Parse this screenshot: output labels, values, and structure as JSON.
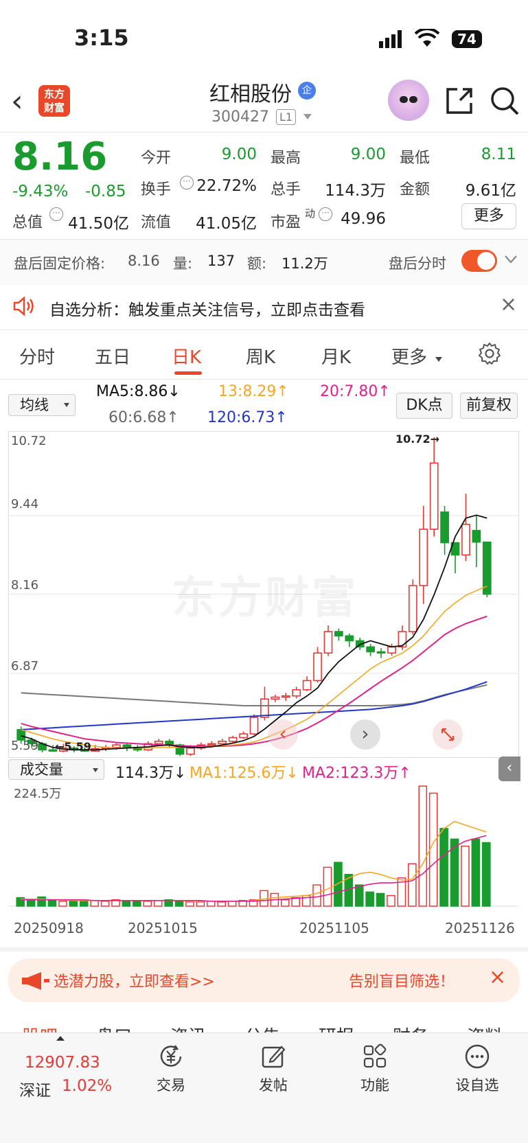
{
  "status_bar": {
    "time": "3:15",
    "battery": "74"
  },
  "header": {
    "logo_line1": "东方",
    "logo_line2": "财富",
    "stock_name": "红相股份",
    "badge": "企",
    "code": "300427",
    "level": "L1"
  },
  "quote": {
    "price": "8.16",
    "change_pct": "-9.43%",
    "change": "-0.85",
    "open_label": "今开",
    "open": "9.00",
    "high_label": "最高",
    "high": "9.00",
    "low_label": "最低",
    "low": "8.11",
    "turnover_label": "换手",
    "turnover": "22.72%",
    "volume_label": "总手",
    "volume": "114.3万",
    "amount_label": "金额",
    "amount": "9.61亿",
    "mcap_label": "总值",
    "mcap": "41.50亿",
    "float_label": "流值",
    "float": "41.05亿",
    "pe_label": "市盈",
    "pe_sup": "动",
    "pe": "49.96",
    "more": "更多"
  },
  "after_hours": {
    "price_label": "盘后固定价格:",
    "price": "8.16",
    "vol_label": "量:",
    "vol": "137",
    "amt_label": "额:",
    "amt": "11.2万",
    "toggle_label": "盘后分时"
  },
  "notice": {
    "text": "自选分析：触发重点关注信号，立即点击查看"
  },
  "tabs": [
    "分时",
    "五日",
    "日K",
    "周K",
    "月K",
    "更多"
  ],
  "ma": {
    "selector": "均线",
    "ma5": "MA5:8.86↓",
    "ma13": "13:8.29↑",
    "ma20": "20:7.80↑",
    "ma60": "60:6.68↑",
    "ma120": "120:6.73↑",
    "dk": "DK点",
    "fq": "前复权"
  },
  "colors": {
    "up": "#e53935",
    "down": "#1a9b2e",
    "ma5": "#111111",
    "ma13": "#f5a623",
    "ma20": "#e0218a",
    "ma60": "#777777",
    "ma120": "#2436c9",
    "accent": "#e8472a"
  },
  "chart": {
    "y_labels": [
      "10.72",
      "9.44",
      "8.16",
      "6.87",
      "5.59"
    ],
    "max_label": "10.72→",
    "min_label": "←5.59",
    "watermark": "东方财富"
  },
  "volume": {
    "selector": "成交量",
    "cur": "114.3万↓",
    "ma1": "MA1:125.6万↓",
    "ma2": "MA2:123.3万↑",
    "max_label": "224.5万"
  },
  "x_labels": [
    "20250918",
    "20251015",
    "20251105",
    "20251126"
  ],
  "chart_data": {
    "type": "candlestick",
    "candles": [
      [
        5.95,
        5.78,
        6.0,
        5.72
      ],
      [
        5.78,
        5.72,
        5.82,
        5.65
      ],
      [
        5.72,
        5.62,
        5.75,
        5.58
      ],
      [
        5.62,
        5.6,
        5.7,
        5.59
      ],
      [
        5.6,
        5.65,
        5.72,
        5.58
      ],
      [
        5.65,
        5.62,
        5.68,
        5.58
      ],
      [
        5.62,
        5.6,
        5.66,
        5.59
      ],
      [
        5.6,
        5.64,
        5.7,
        5.59
      ],
      [
        5.64,
        5.66,
        5.7,
        5.6
      ],
      [
        5.66,
        5.7,
        5.74,
        5.62
      ],
      [
        5.7,
        5.66,
        5.72,
        5.6
      ],
      [
        5.66,
        5.62,
        5.7,
        5.59
      ],
      [
        5.62,
        5.72,
        5.76,
        5.6
      ],
      [
        5.72,
        5.76,
        5.8,
        5.68
      ],
      [
        5.76,
        5.7,
        5.8,
        5.66
      ],
      [
        5.7,
        5.55,
        5.72,
        5.52
      ],
      [
        5.55,
        5.65,
        5.7,
        5.52
      ],
      [
        5.65,
        5.7,
        5.74,
        5.62
      ],
      [
        5.7,
        5.72,
        5.76,
        5.66
      ],
      [
        5.72,
        5.76,
        5.8,
        5.7
      ],
      [
        5.76,
        5.82,
        5.85,
        5.74
      ],
      [
        5.82,
        5.88,
        5.92,
        5.8
      ],
      [
        5.88,
        6.15,
        6.2,
        5.86
      ],
      [
        6.15,
        6.45,
        6.65,
        6.1
      ],
      [
        6.45,
        6.48,
        6.52,
        6.4
      ],
      [
        6.48,
        6.5,
        6.55,
        6.42
      ],
      [
        6.5,
        6.6,
        6.65,
        6.46
      ],
      [
        6.6,
        6.75,
        6.82,
        6.58
      ],
      [
        6.75,
        7.2,
        7.3,
        6.72
      ],
      [
        7.2,
        7.55,
        7.65,
        7.15
      ],
      [
        7.55,
        7.48,
        7.6,
        7.4
      ],
      [
        7.48,
        7.4,
        7.52,
        7.3
      ],
      [
        7.4,
        7.3,
        7.45,
        7.25
      ],
      [
        7.3,
        7.22,
        7.35,
        7.15
      ],
      [
        7.22,
        7.2,
        7.28,
        7.12
      ],
      [
        7.2,
        7.3,
        7.35,
        7.16
      ],
      [
        7.3,
        7.55,
        7.65,
        7.25
      ],
      [
        7.55,
        8.3,
        8.4,
        7.5
      ],
      [
        8.3,
        9.22,
        9.6,
        8.0
      ],
      [
        9.22,
        10.3,
        10.72,
        9.1
      ],
      [
        9.5,
        9.0,
        9.6,
        8.8
      ],
      [
        9.0,
        8.8,
        9.0,
        8.5
      ],
      [
        8.8,
        9.3,
        9.8,
        8.7
      ],
      [
        9.2,
        9.01,
        9.45,
        8.6
      ],
      [
        9.01,
        8.16,
        9.0,
        8.11
      ]
    ],
    "ma5": [
      5.85,
      5.8,
      5.72,
      5.66,
      5.63,
      5.62,
      5.62,
      5.62,
      5.63,
      5.64,
      5.65,
      5.66,
      5.67,
      5.69,
      5.7,
      5.67,
      5.66,
      5.66,
      5.67,
      5.7,
      5.73,
      5.77,
      5.84,
      5.96,
      6.1,
      6.24,
      6.39,
      6.5,
      6.63,
      6.87,
      7.06,
      7.2,
      7.34,
      7.4,
      7.35,
      7.3,
      7.32,
      7.46,
      7.75,
      8.15,
      8.6,
      9.1,
      9.4,
      9.45,
      9.4
    ],
    "ma13": [
      5.95,
      5.9,
      5.85,
      5.8,
      5.76,
      5.73,
      5.7,
      5.68,
      5.66,
      5.65,
      5.65,
      5.65,
      5.65,
      5.66,
      5.66,
      5.66,
      5.66,
      5.67,
      5.68,
      5.69,
      5.7,
      5.72,
      5.75,
      5.81,
      5.88,
      5.95,
      6.03,
      6.12,
      6.24,
      6.38,
      6.52,
      6.66,
      6.8,
      6.94,
      7.05,
      7.12,
      7.2,
      7.32,
      7.48,
      7.68,
      7.88,
      8.02,
      8.14,
      8.22,
      8.29
    ],
    "ma20": [
      6.05,
      6.0,
      5.96,
      5.92,
      5.88,
      5.84,
      5.8,
      5.78,
      5.76,
      5.74,
      5.73,
      5.72,
      5.71,
      5.7,
      5.7,
      5.69,
      5.68,
      5.68,
      5.68,
      5.68,
      5.69,
      5.7,
      5.72,
      5.75,
      5.79,
      5.84,
      5.9,
      5.97,
      6.06,
      6.16,
      6.27,
      6.38,
      6.5,
      6.62,
      6.74,
      6.85,
      6.96,
      7.08,
      7.22,
      7.36,
      7.5,
      7.6,
      7.68,
      7.74,
      7.8
    ],
    "ma60": [
      6.55,
      6.54,
      6.53,
      6.52,
      6.51,
      6.5,
      6.49,
      6.48,
      6.47,
      6.46,
      6.45,
      6.44,
      6.43,
      6.42,
      6.41,
      6.4,
      6.39,
      6.38,
      6.37,
      6.36,
      6.35,
      6.34,
      6.34,
      6.34,
      6.34,
      6.34,
      6.34,
      6.34,
      6.34,
      6.34,
      6.34,
      6.34,
      6.34,
      6.34,
      6.34,
      6.35,
      6.36,
      6.38,
      6.42,
      6.47,
      6.52,
      6.56,
      6.6,
      6.64,
      6.68
    ],
    "ma120": [
      5.95,
      5.96,
      5.97,
      5.98,
      5.99,
      6.0,
      6.01,
      6.02,
      6.03,
      6.04,
      6.05,
      6.06,
      6.07,
      6.08,
      6.09,
      6.1,
      6.11,
      6.12,
      6.13,
      6.14,
      6.15,
      6.16,
      6.17,
      6.18,
      6.19,
      6.2,
      6.21,
      6.22,
      6.23,
      6.24,
      6.25,
      6.26,
      6.27,
      6.28,
      6.3,
      6.32,
      6.34,
      6.37,
      6.41,
      6.46,
      6.51,
      6.56,
      6.61,
      6.67,
      6.73
    ],
    "volumes": [
      12,
      9,
      13,
      8,
      7,
      8,
      7,
      8,
      7,
      9,
      7,
      8,
      7,
      8,
      9,
      7,
      6,
      6,
      7,
      6,
      7,
      8,
      9,
      22,
      18,
      9,
      12,
      15,
      30,
      55,
      62,
      45,
      30,
      20,
      18,
      15,
      40,
      60,
      170,
      160,
      110,
      95,
      85,
      95,
      90
    ],
    "vol_ma1": [
      10,
      10,
      10,
      9,
      9,
      8,
      8,
      8,
      8,
      8,
      8,
      8,
      8,
      8,
      8,
      8,
      7,
      7,
      7,
      7,
      7,
      7,
      8,
      10,
      12,
      13,
      14,
      15,
      18,
      24,
      32,
      40,
      46,
      48,
      45,
      40,
      37,
      38,
      60,
      90,
      110,
      120,
      115,
      110,
      105
    ],
    "vol_ma2": [
      9,
      9,
      9,
      9,
      9,
      9,
      9,
      8,
      8,
      8,
      8,
      8,
      8,
      8,
      8,
      8,
      8,
      8,
      7,
      7,
      7,
      7,
      7,
      8,
      9,
      10,
      11,
      12,
      13,
      16,
      20,
      24,
      28,
      31,
      33,
      33,
      34,
      36,
      46,
      60,
      72,
      84,
      92,
      96,
      100
    ]
  },
  "banner": {
    "left": "选潜力股，立即查看>>",
    "right": "告别盲目筛选！"
  },
  "bottom_tabs": [
    "股吧",
    "盘口",
    "资讯",
    "公告",
    "研报",
    "财务",
    "资料"
  ],
  "nav": {
    "index_value": "12907.83",
    "index_name": "深证",
    "index_pct": "1.02%",
    "trade": "交易",
    "post": "发帖",
    "func": "功能",
    "watch": "设自选"
  }
}
